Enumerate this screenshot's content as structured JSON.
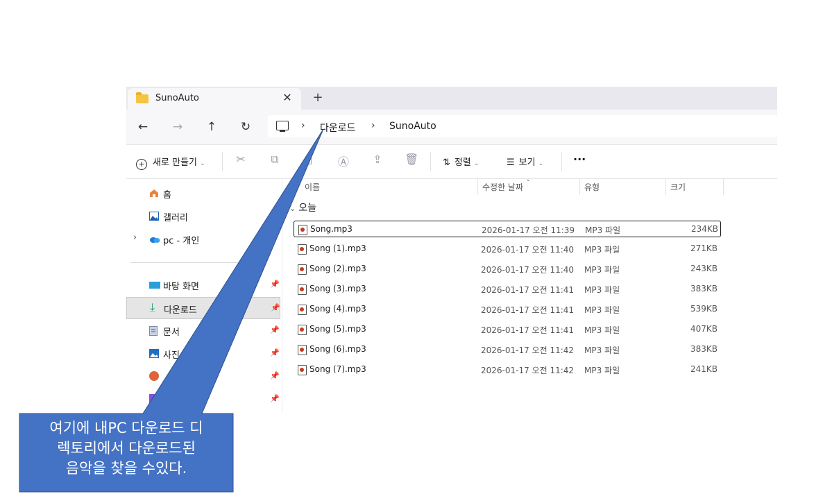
{
  "tab": {
    "title": "SunoAuto",
    "close": "✕",
    "new": "+"
  },
  "nav": {
    "back": "←",
    "forward": "→",
    "up": "↑",
    "refresh": "↻"
  },
  "breadcrumb": {
    "sep": "›",
    "items": [
      "다운로드",
      "SunoAuto"
    ]
  },
  "toolbar": {
    "new_label": "새로 만들기",
    "sort_label": "정렬",
    "view_label": "보기",
    "more": "···"
  },
  "sidebar": {
    "items": [
      {
        "label": "홈",
        "icon": "home-icon"
      },
      {
        "label": "갤러리",
        "icon": "gallery-icon"
      },
      {
        "label": "pc - 개인",
        "icon": "cloud-icon"
      },
      {
        "label": "바탕 화면",
        "icon": "desktop-icon"
      },
      {
        "label": "다운로드",
        "icon": "download-icon"
      },
      {
        "label": "문서",
        "icon": "document-icon"
      },
      {
        "label": "사진",
        "icon": "pictures-icon"
      }
    ]
  },
  "columns": {
    "name": "이름",
    "modified": "수정한 날짜",
    "type": "유형",
    "size": "크기"
  },
  "group_label": "오늘",
  "files": [
    {
      "name": "Song.mp3",
      "modified": "2026-01-17 오전 11:39",
      "type": "MP3 파일",
      "size": "234KB"
    },
    {
      "name": "Song (1).mp3",
      "modified": "2026-01-17 오전 11:40",
      "type": "MP3 파일",
      "size": "271KB"
    },
    {
      "name": "Song (2).mp3",
      "modified": "2026-01-17 오전 11:40",
      "type": "MP3 파일",
      "size": "243KB"
    },
    {
      "name": "Song (3).mp3",
      "modified": "2026-01-17 오전 11:41",
      "type": "MP3 파일",
      "size": "383KB"
    },
    {
      "name": "Song (4).mp3",
      "modified": "2026-01-17 오전 11:41",
      "type": "MP3 파일",
      "size": "539KB"
    },
    {
      "name": "Song (5).mp3",
      "modified": "2026-01-17 오전 11:41",
      "type": "MP3 파일",
      "size": "407KB"
    },
    {
      "name": "Song (6).mp3",
      "modified": "2026-01-17 오전 11:42",
      "type": "MP3 파일",
      "size": "383KB"
    },
    {
      "name": "Song (7).mp3",
      "modified": "2026-01-17 오전 11:42",
      "type": "MP3 파일",
      "size": "241KB"
    }
  ],
  "callout": {
    "lines": [
      "여기에 내PC 다운로드 디",
      "렉토리에서 다운로드된",
      "음악을 찾을 수있다."
    ],
    "color": "#4472c4"
  }
}
